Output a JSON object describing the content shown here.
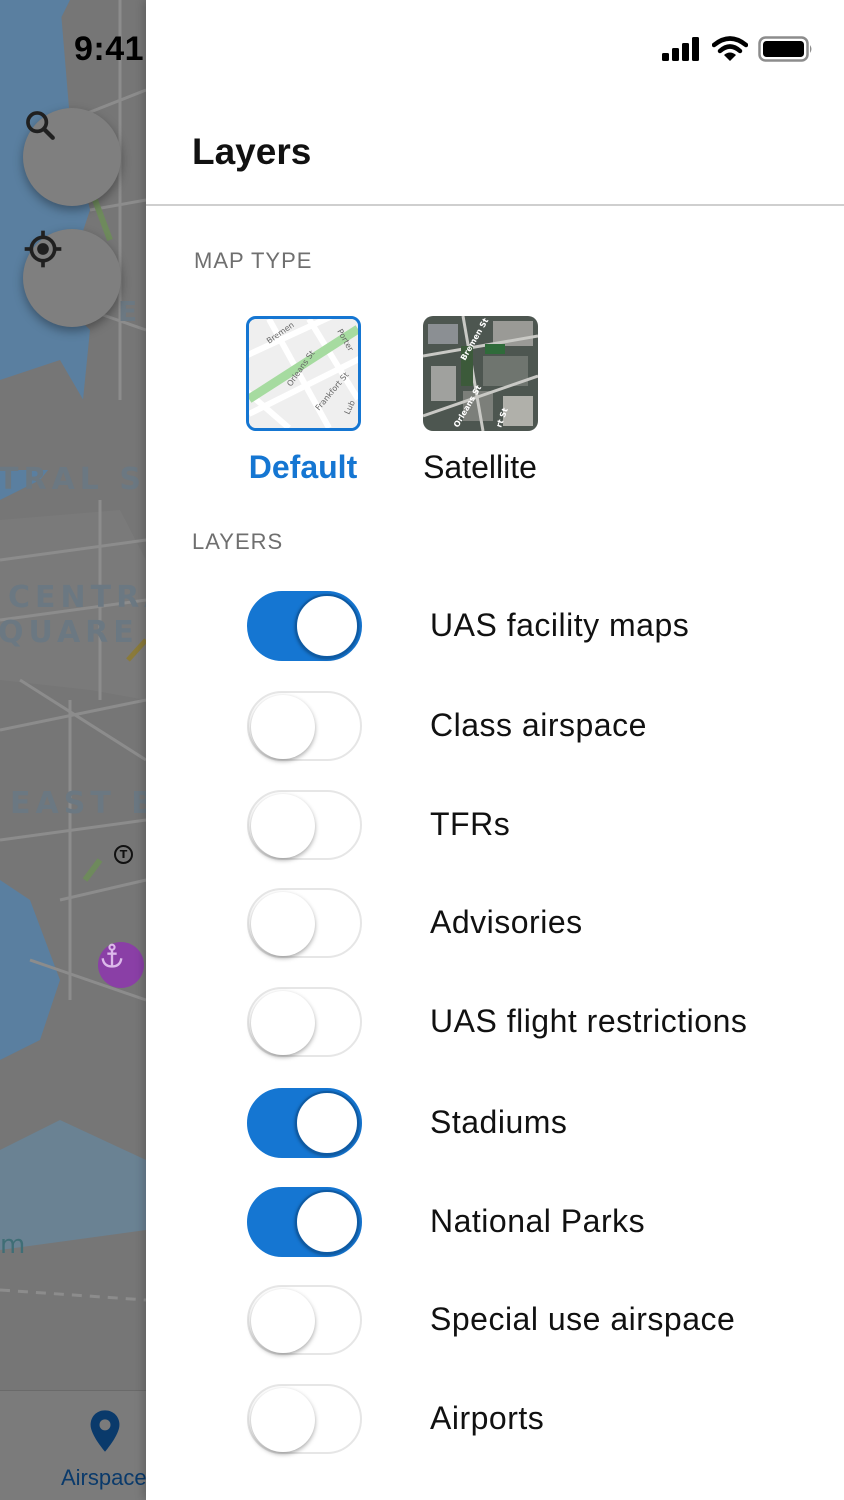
{
  "status_bar": {
    "time": "9:41"
  },
  "map": {
    "labels": [
      "E",
      "TRAL S",
      "CENTRA",
      "QUARE /",
      "EAST B",
      "m"
    ],
    "transit_marker": "T"
  },
  "bottom_nav": {
    "active_item_label": "Airspace",
    "active_color": "#0a3a6b"
  },
  "drawer": {
    "title": "Layers",
    "map_type_section": {
      "label": "MAP TYPE",
      "options": [
        {
          "label": "Default",
          "selected": true
        },
        {
          "label": "Satellite",
          "selected": false
        }
      ],
      "default_thumb_streets": [
        "Bremen",
        "Porter",
        "Orleans St",
        "Frankfort St",
        "Lub"
      ],
      "satellite_thumb_streets": [
        "Bremen St",
        "Orleans St",
        "rt St"
      ]
    },
    "layers_section": {
      "label": "LAYERS",
      "items": [
        {
          "label": "UAS facility maps",
          "enabled": true
        },
        {
          "label": "Class airspace",
          "enabled": false
        },
        {
          "label": "TFRs",
          "enabled": false
        },
        {
          "label": "Advisories",
          "enabled": false
        },
        {
          "label": "UAS flight restrictions",
          "enabled": false
        },
        {
          "label": "Stadiums",
          "enabled": true
        },
        {
          "label": "National Parks",
          "enabled": true
        },
        {
          "label": "Special use airspace",
          "enabled": false
        },
        {
          "label": "Airports",
          "enabled": false
        }
      ]
    },
    "accent_color": "#1576d2"
  }
}
